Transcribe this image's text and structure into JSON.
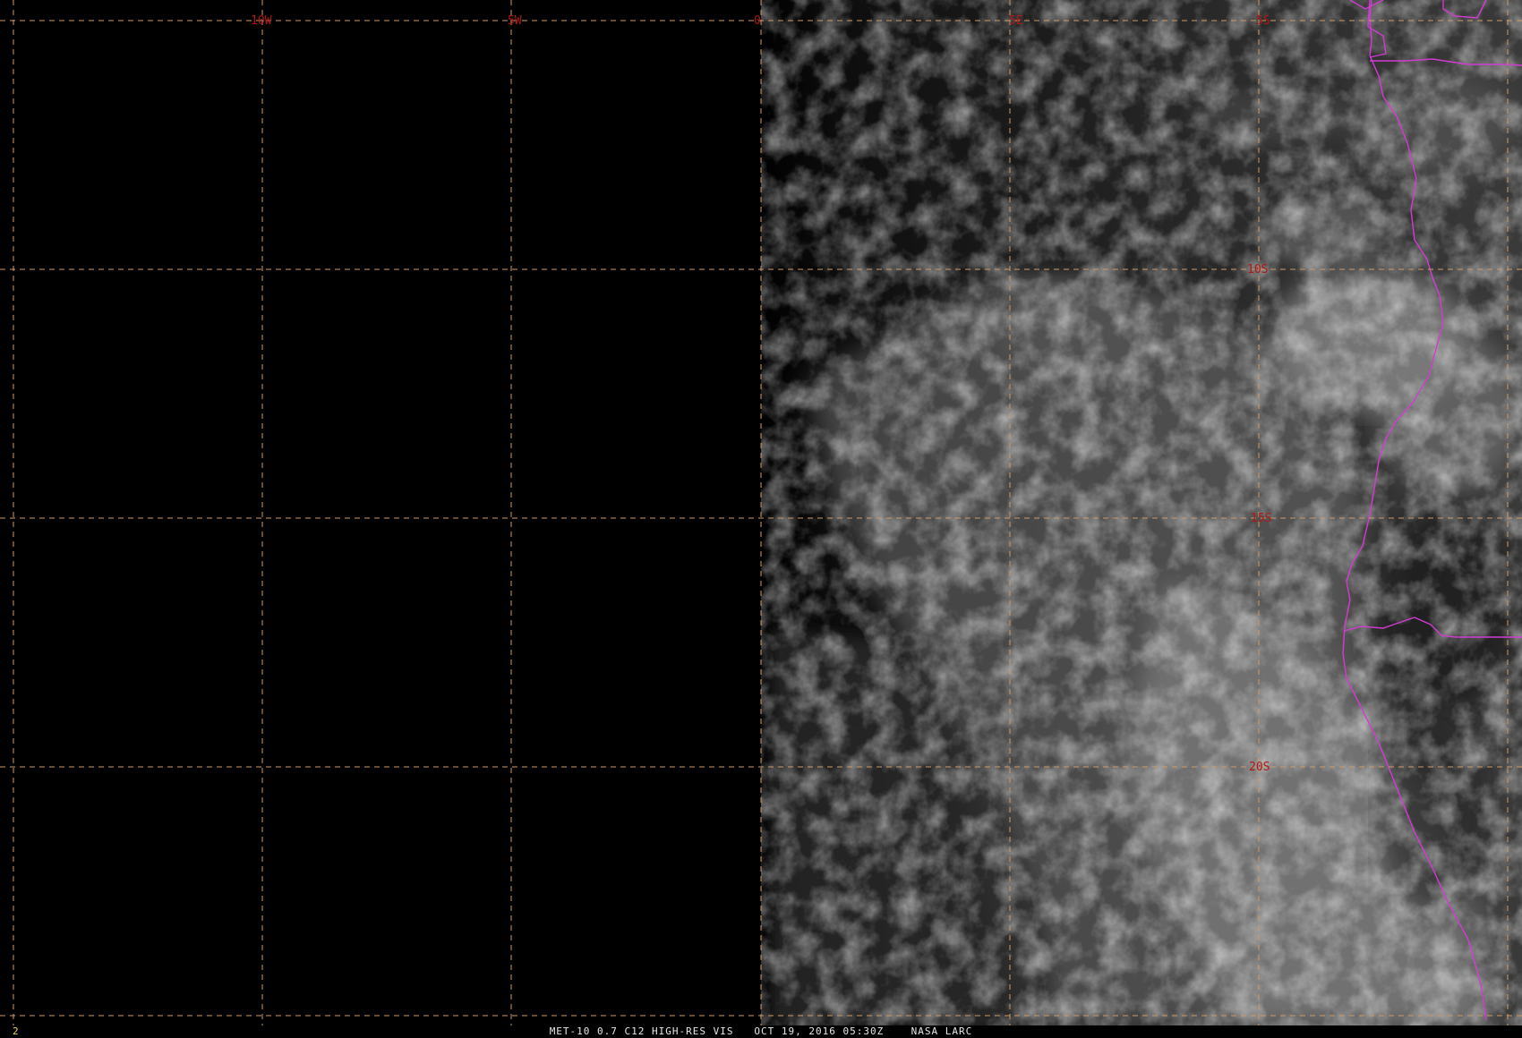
{
  "grid_labels": {
    "longitude": [
      "10W",
      "5W",
      "0",
      "5E"
    ],
    "latitude": [
      "5S",
      "10S",
      "15S",
      "20S"
    ]
  },
  "caption": "MET-10 0.7 C12 HIGH-RES VIS   OCT 19, 2016 05:30Z    NASA LARC",
  "frame_number": "2",
  "colors": {
    "graticule": "#d09a6a",
    "grid_label": "#b01818",
    "borders": "#d23cd2",
    "frame_number": "#e6d84a",
    "caption": "#e6e6e6"
  }
}
